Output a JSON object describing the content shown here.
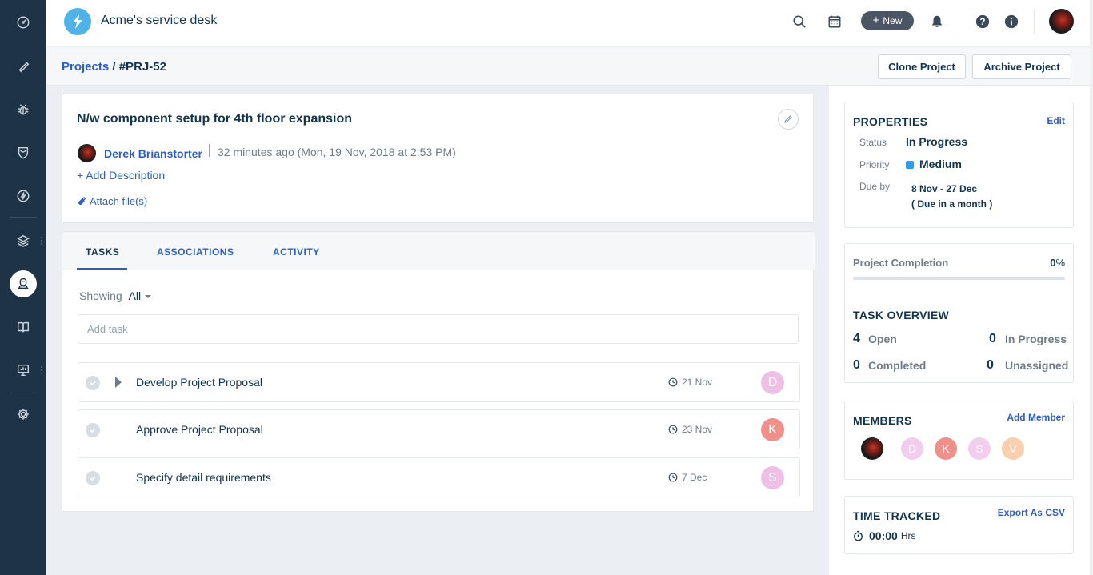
{
  "app": {
    "name": "Acme's service desk"
  },
  "topbar": {
    "new_label": "New"
  },
  "breadcrumb": {
    "parent": "Projects",
    "separator": " / ",
    "current": "#PRJ-52"
  },
  "actions": {
    "clone": "Clone Project",
    "archive": "Archive Project"
  },
  "project": {
    "title": "N/w component setup for 4th floor expansion",
    "author": "Derek Brianstorter",
    "created": "32 minutes ago (Mon, 19 Nov, 2018 at 2:53 PM)",
    "add_description": "+ Add Description",
    "attach": "Attach file(s)"
  },
  "tabs": [
    "TASKS",
    "ASSOCIATIONS",
    "ACTIVITY"
  ],
  "filter": {
    "label": "Showing",
    "value": "All"
  },
  "add_task_placeholder": "Add task",
  "tasks": [
    {
      "name": "Develop Project Proposal",
      "date": "21 Nov",
      "assignee": "D",
      "color": "#efc0e6"
    },
    {
      "name": "Approve Project Proposal",
      "date": "23 Nov",
      "assignee": "K",
      "color": "#f0908b"
    },
    {
      "name": "Specify detail requirements",
      "date": "7 Dec",
      "assignee": "S",
      "color": "#efc0e6"
    }
  ],
  "properties": {
    "heading": "PROPERTIES",
    "edit": "Edit",
    "status_label": "Status",
    "status": "In Progress",
    "priority_label": "Priority",
    "priority": "Medium",
    "priority_color": "#2c9ee8",
    "due_label": "Due by",
    "due_range": "8 Nov - 27 Dec",
    "due_note": "( Due in a month )"
  },
  "completion": {
    "label": "Project Completion",
    "value": "0",
    "unit": "%",
    "progress": 0
  },
  "overview": {
    "heading": "TASK OVERVIEW",
    "open_count": "4",
    "open_label": "Open",
    "inprogress_count": "0",
    "inprogress_label": "In Progress",
    "completed_count": "0",
    "completed_label": "Completed",
    "unassigned_count": "0",
    "unassigned_label": "Unassigned"
  },
  "members": {
    "heading": "MEMBERS",
    "add": "Add Member",
    "list": [
      {
        "initial": "D",
        "color": "#f3cdee"
      },
      {
        "initial": "K",
        "color": "#f0908b"
      },
      {
        "initial": "S",
        "color": "#f3cdee"
      },
      {
        "initial": "V",
        "color": "#f9cfae"
      }
    ]
  },
  "time": {
    "heading": "TIME TRACKED",
    "export": "Export As CSV",
    "value": "00:00",
    "unit": "Hrs"
  }
}
